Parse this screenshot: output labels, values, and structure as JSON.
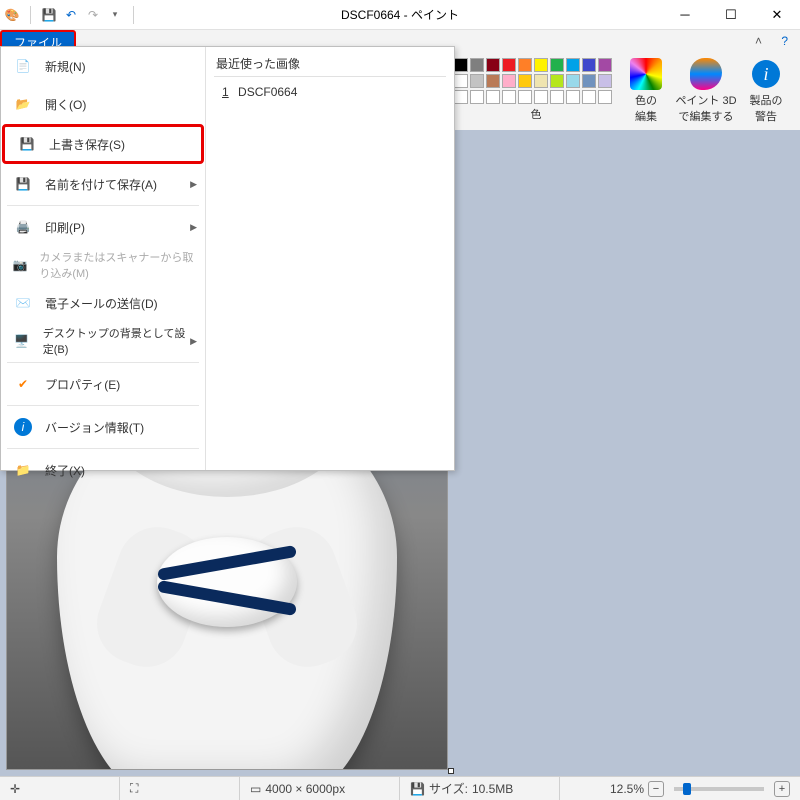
{
  "title": "DSCF0664 - ペイント",
  "tabs": {
    "file": "ファイル"
  },
  "ribbon": {
    "color_edit": "色の\n編集",
    "paint3d": "ペイント 3D\nで編集する",
    "product_info": "製品の\n警告",
    "colors_label": "色",
    "palette": {
      "row1": [
        "#000000",
        "#7f7f7f",
        "#880015",
        "#ed1c24",
        "#ff7f27",
        "#fff200",
        "#22b14c",
        "#00a2e8",
        "#3f48cc",
        "#a349a4"
      ],
      "row2": [
        "#ffffff",
        "#c3c3c3",
        "#b97a57",
        "#ffaec9",
        "#ffc90e",
        "#efe4b0",
        "#b5e61d",
        "#99d9ea",
        "#7092be",
        "#c8bfe7"
      ],
      "row3": [
        "#ffffff",
        "#ffffff",
        "#ffffff",
        "#ffffff",
        "#ffffff",
        "#ffffff",
        "#ffffff",
        "#ffffff",
        "#ffffff",
        "#ffffff"
      ]
    }
  },
  "file_menu": {
    "recent_header": "最近使った画像",
    "recent": [
      {
        "index": "1",
        "name": "DSCF0664"
      }
    ],
    "items": {
      "new": "新規(N)",
      "open": "開く(O)",
      "save": "上書き保存(S)",
      "save_as": "名前を付けて保存(A)",
      "print": "印刷(P)",
      "scanner": "カメラまたはスキャナーから取り込み(M)",
      "email": "電子メールの送信(D)",
      "wallpaper": "デスクトップの背景として設定(B)",
      "properties": "プロパティ(E)",
      "about": "バージョン情報(T)",
      "exit": "終了(X)"
    }
  },
  "status": {
    "dimensions": "4000 × 6000px",
    "size_label": "サイズ:",
    "size_value": "10.5MB",
    "zoom": "12.5%"
  }
}
